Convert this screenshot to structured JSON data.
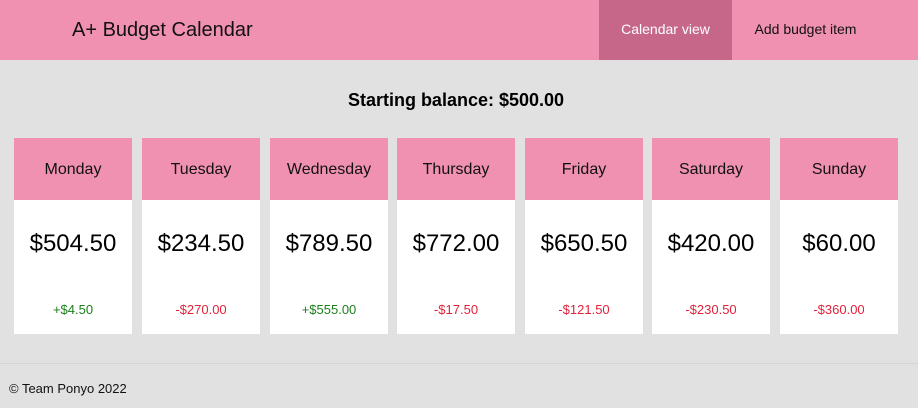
{
  "app": {
    "title": "A+ Budget Calendar"
  },
  "nav": {
    "tabs": [
      {
        "label": "Calendar view",
        "active": true
      },
      {
        "label": "Add budget item",
        "active": false
      }
    ]
  },
  "summary": {
    "starting_balance_text": "Starting balance: $500.00"
  },
  "days": [
    {
      "name": "Monday",
      "balance": "$504.50",
      "change": "+$4.50",
      "direction": "positive"
    },
    {
      "name": "Tuesday",
      "balance": "$234.50",
      "change": "-$270.00",
      "direction": "negative"
    },
    {
      "name": "Wednesday",
      "balance": "$789.50",
      "change": "+$555.00",
      "direction": "positive"
    },
    {
      "name": "Thursday",
      "balance": "$772.00",
      "change": "-$17.50",
      "direction": "negative"
    },
    {
      "name": "Friday",
      "balance": "$650.50",
      "change": "-$121.50",
      "direction": "negative"
    },
    {
      "name": "Saturday",
      "balance": "$420.00",
      "change": "-$230.50",
      "direction": "negative"
    },
    {
      "name": "Sunday",
      "balance": "$60.00",
      "change": "-$360.00",
      "direction": "negative"
    }
  ],
  "footer": {
    "text": "© Team Ponyo 2022"
  },
  "colors": {
    "accent": "#f191b2",
    "accent_active": "#c6678a",
    "background": "#e1e1e1",
    "positive": "#1b7f1b",
    "negative": "#e0223a"
  }
}
